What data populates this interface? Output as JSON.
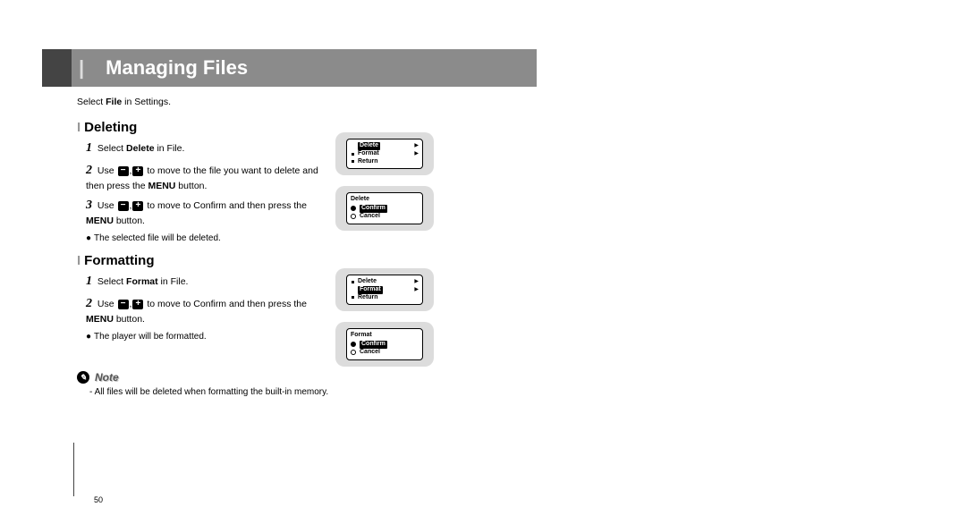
{
  "page_number": "50",
  "title": "Managing Files",
  "intro_pre": "Select ",
  "intro_bold": "File",
  "intro_post": " in Settings.",
  "sections": {
    "deleting": {
      "heading": "Deleting",
      "step1_pre": "Select ",
      "step1_bold": "Delete",
      "step1_post": " in File.",
      "step2_pre": "Use ",
      "step2_mid": " to move to the file you want to delete and then press the ",
      "step2_bold": "MENU",
      "step2_post": " button.",
      "step3_pre": "Use ",
      "step3_mid": "to move to Confirm and then press the ",
      "step3_bold": "MENU",
      "step3_post": " button.",
      "bullet": "The selected file will be deleted."
    },
    "formatting": {
      "heading": "Formatting",
      "step1_pre": "Select ",
      "step1_bold": "Format",
      "step1_post": " in File.",
      "step2_pre": "Use ",
      "step2_mid": " to move to Confirm and then press the ",
      "step2_bold": "MENU",
      "step2_post": " button.",
      "bullet": "The player will be formatted."
    }
  },
  "note": {
    "label": "Note",
    "text": "All files will be deleted when formatting the built-in memory."
  },
  "screens": {
    "del_menu": {
      "r1": "Delete",
      "r2": "Format",
      "r3": "Return"
    },
    "del_confirm": {
      "title": "Delete",
      "r1": "Confirm",
      "r2": "Cancel"
    },
    "fmt_menu": {
      "r1": "Delete",
      "r2": "Format",
      "r3": "Return"
    },
    "fmt_confirm": {
      "title": "Format",
      "r1": "Confirm",
      "r2": "Cancel"
    }
  },
  "icons": {
    "minus": "−",
    "plus": "+"
  }
}
